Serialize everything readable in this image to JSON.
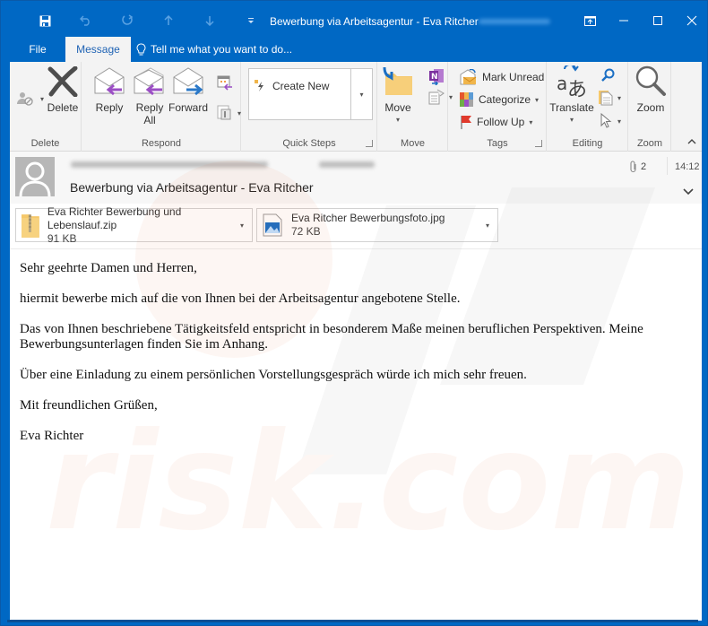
{
  "window": {
    "title": "Bewerbung via Arbeitsagentur - Eva Ritcher",
    "controls": [
      "restore-ribbon",
      "minimize",
      "maximize",
      "close"
    ]
  },
  "quick_access": [
    "save",
    "undo",
    "redo",
    "previous-item",
    "next-item",
    "customize"
  ],
  "tabs": {
    "file": "File",
    "message": "Message",
    "tellme": "Tell me what you want to do..."
  },
  "ribbon": {
    "groups": {
      "delete": "Delete",
      "respond": "Respond",
      "quick_steps": "Quick Steps",
      "move": "Move",
      "tags": "Tags",
      "editing": "Editing",
      "zoom": "Zoom"
    },
    "buttons": {
      "delete": "Delete",
      "reply": "Reply",
      "reply_all_line1": "Reply",
      "reply_all_line2": "All",
      "forward": "Forward",
      "create_new": "Create New",
      "move": "Move",
      "mark_unread": "Mark Unread",
      "categorize": "Categorize",
      "follow_up": "Follow Up",
      "translate": "Translate",
      "zoom": "Zoom"
    }
  },
  "message": {
    "subject": "Bewerbung via Arbeitsagentur - Eva Ritcher",
    "attachment_count": "2",
    "time": "14:12",
    "attachments": [
      {
        "name": "Eva Richter Bewerbung und Lebenslauf.zip",
        "size": "91 KB",
        "type": "zip"
      },
      {
        "name": "Eva Ritcher Bewerbungsfoto.jpg",
        "size": "72 KB",
        "type": "image"
      }
    ],
    "body": [
      "Sehr geehrte Damen und Herren,",
      "hiermit bewerbe mich auf die von Ihnen bei der Arbeitsagentur angebotene Stelle.",
      "Das von Ihnen beschriebene Tätigkeitsfeld entspricht in besonderem Maße meinen beruflichen Perspektiven. Meine Bewerbungsunterlagen finden Sie im Anhang.",
      "Über eine Einladung zu einem persönlichen Vorstellungsgespräch würde ich mich sehr freuen.",
      "Mit freundlichen Grüßen,",
      "Eva Richter"
    ]
  },
  "colors": {
    "frame": "#0068c4",
    "ribbon": "#f3f3f3",
    "active_tab_text": "#1f63b4",
    "reply_arrow": "#9b4fc4",
    "forward_arrow": "#2a78c8",
    "folder": "#f5c86a",
    "flag": "#e03a2c"
  }
}
